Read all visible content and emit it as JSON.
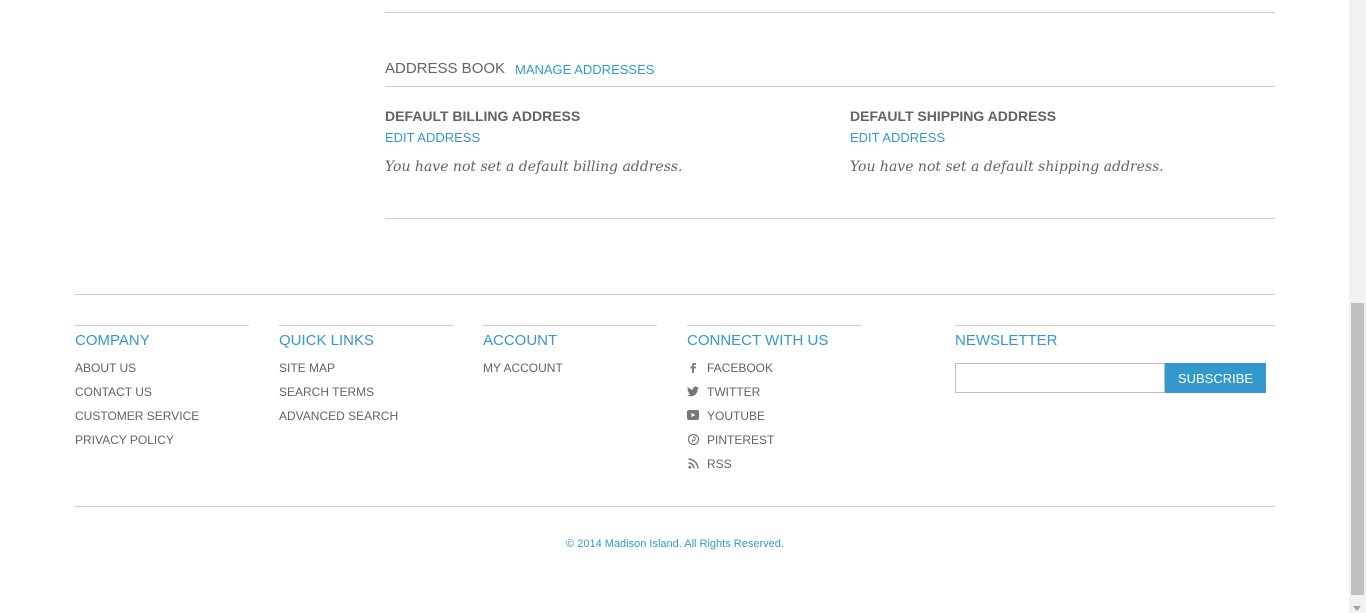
{
  "address_book": {
    "title": "ADDRESS BOOK",
    "manage_link": "MANAGE ADDRESSES",
    "billing": {
      "title": "DEFAULT BILLING ADDRESS",
      "edit": "EDIT ADDRESS",
      "empty": "You have not set a default billing address."
    },
    "shipping": {
      "title": "DEFAULT SHIPPING ADDRESS",
      "edit": "EDIT ADDRESS",
      "empty": "You have not set a default shipping address."
    }
  },
  "footer": {
    "company": {
      "title": "COMPANY",
      "links": [
        "ABOUT US",
        "CONTACT US",
        "CUSTOMER SERVICE",
        "PRIVACY POLICY"
      ]
    },
    "quick_links": {
      "title": "QUICK LINKS",
      "links": [
        "SITE MAP",
        "SEARCH TERMS",
        "ADVANCED SEARCH"
      ]
    },
    "account": {
      "title": "ACCOUNT",
      "links": [
        "MY ACCOUNT"
      ]
    },
    "connect": {
      "title": "CONNECT WITH US",
      "links": [
        {
          "label": "FACEBOOK",
          "icon": "facebook-icon"
        },
        {
          "label": "TWITTER",
          "icon": "twitter-icon"
        },
        {
          "label": "YOUTUBE",
          "icon": "youtube-icon"
        },
        {
          "label": "PINTEREST",
          "icon": "pinterest-icon"
        },
        {
          "label": "RSS",
          "icon": "rss-icon"
        }
      ]
    },
    "newsletter": {
      "title": "NEWSLETTER",
      "input_value": "",
      "button": "SUBSCRIBE"
    },
    "copyright": "© 2014 Madison Island. All Rights Reserved."
  },
  "colors": {
    "accent": "#3399cc",
    "text": "#636363",
    "divider": "#cccccc"
  }
}
